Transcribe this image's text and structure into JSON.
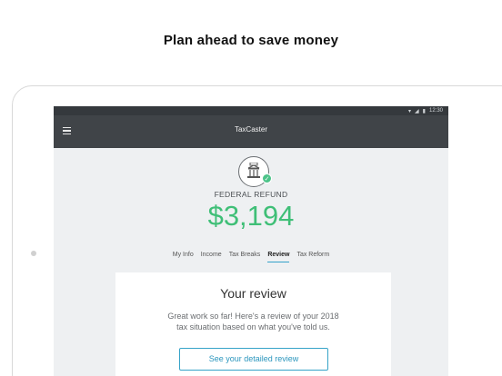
{
  "headline": "Plan ahead to save money",
  "status_bar": {
    "time": "12:30"
  },
  "app_bar": {
    "title": "TaxCaster",
    "menu_icon": "hamburger-menu-icon"
  },
  "summary": {
    "emblem_icon": "capitol-building-icon",
    "check_icon": "checkmark-icon",
    "label": "FEDERAL REFUND",
    "amount": "$3,194"
  },
  "tabs": [
    {
      "label": "My Info"
    },
    {
      "label": "Income"
    },
    {
      "label": "Tax Breaks"
    },
    {
      "label": "Review",
      "active": true
    },
    {
      "label": "Tax Reform"
    }
  ],
  "review_card": {
    "title": "Your review",
    "body": "Great work so far! Here's a review of your 2018 tax situation based on what you've told us.",
    "button_label": "See your detailed review"
  },
  "colors": {
    "accent": "#36a3c8",
    "refund_green": "#3fbf77",
    "app_bar": "#404448"
  }
}
